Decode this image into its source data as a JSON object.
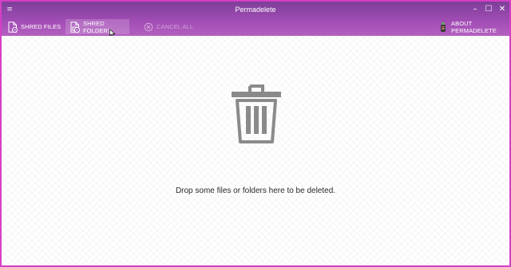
{
  "window": {
    "title": "Permadelete",
    "system_menu_glyph": "≡",
    "controls": {
      "minimize_glyph": "–",
      "maximize_glyph": "☐",
      "close_glyph": "✕"
    }
  },
  "toolbar": {
    "shred_files_label": "SHRED FILES",
    "shred_files_icon": "file-shred-icon",
    "shred_folders_label": "SHRED FOLDERS",
    "shred_folders_icon": "folder-shred-icon",
    "cancel_all_label": "CANCEL ALL",
    "cancel_all_icon": "cancel-circle-icon",
    "about_label": "ABOUT PERMADELETE",
    "about_icon": "app-logo-icon"
  },
  "drop_area": {
    "icon": "trash-bin-icon",
    "message": "Drop some files or folders here to be deleted."
  },
  "colors": {
    "accent_top": "#7d3f98",
    "accent_bottom": "#b35fc0",
    "window_border": "#d63fc6",
    "trash_icon": "#8a8a8a"
  }
}
